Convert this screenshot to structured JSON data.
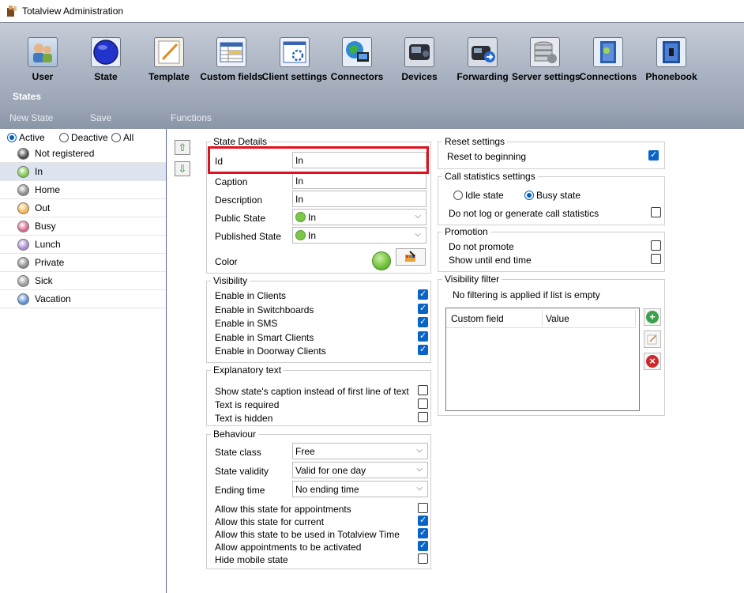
{
  "window": {
    "title": "Totalview  Administration"
  },
  "toolbar": {
    "section": "States",
    "items": [
      {
        "label": "User",
        "icon": "user-icon"
      },
      {
        "label": "State",
        "icon": "state-icon"
      },
      {
        "label": "Template",
        "icon": "template-icon"
      },
      {
        "label": "Custom fields",
        "icon": "custom-fields-icon"
      },
      {
        "label": "Client settings",
        "icon": "client-settings-icon"
      },
      {
        "label": "Connectors",
        "icon": "connectors-icon"
      },
      {
        "label": "Devices",
        "icon": "devices-icon"
      },
      {
        "label": "Forwarding",
        "icon": "forwarding-icon"
      },
      {
        "label": "Server settings",
        "icon": "server-settings-icon"
      },
      {
        "label": "Connections",
        "icon": "connections-icon"
      },
      {
        "label": "Phonebook",
        "icon": "phonebook-icon"
      }
    ]
  },
  "actions": {
    "new_state": "New State",
    "save": "Save",
    "functions": "Functions"
  },
  "filter": {
    "active": "Active",
    "deactive": "Deactive",
    "all": "All",
    "selected": "Active"
  },
  "states": [
    {
      "label": "Not registered",
      "color": "#4a4a4a"
    },
    {
      "label": "In",
      "color": "#7cc94a"
    },
    {
      "label": "Home",
      "color": "#8a8a8a"
    },
    {
      "label": "Out",
      "color": "#f2b64c"
    },
    {
      "label": "Busy",
      "color": "#d96a92"
    },
    {
      "label": "Lunch",
      "color": "#a98ad0"
    },
    {
      "label": "Private",
      "color": "#8a8a8a"
    },
    {
      "label": "Sick",
      "color": "#9a9a9a"
    },
    {
      "label": "Vacation",
      "color": "#5a8fd0"
    }
  ],
  "selected_state": "In",
  "state_details": {
    "title": "State Details",
    "id_label": "Id",
    "id_value": "In",
    "caption_label": "Caption",
    "caption_value": "In",
    "description_label": "Description",
    "description_value": "In",
    "public_state_label": "Public State",
    "public_state_value": "In",
    "published_state_label": "Published State",
    "published_state_value": "In",
    "color_label": "Color"
  },
  "visibility": {
    "title": "Visibility",
    "items": [
      {
        "label": "Enable in Clients",
        "checked": true
      },
      {
        "label": "Enable in Switchboards",
        "checked": true
      },
      {
        "label": "Enable in SMS",
        "checked": true
      },
      {
        "label": "Enable in Smart Clients",
        "checked": true
      },
      {
        "label": "Enable in Doorway Clients",
        "checked": true
      }
    ]
  },
  "explanatory": {
    "title": "Explanatory text",
    "items": [
      {
        "label": "Show state's caption instead of first line of text",
        "checked": false
      },
      {
        "label": "Text is required",
        "checked": false
      },
      {
        "label": "Text is hidden",
        "checked": false
      }
    ]
  },
  "behaviour": {
    "title": "Behaviour",
    "state_class_label": "State class",
    "state_class_value": "Free",
    "state_validity_label": "State validity",
    "state_validity_value": "Valid for one day",
    "ending_time_label": "Ending time",
    "ending_time_value": "No ending time",
    "items": [
      {
        "label": "Allow this state for appointments",
        "checked": false
      },
      {
        "label": "Allow this state for current",
        "checked": true
      },
      {
        "label": "Allow this state to be used in Totalview Time",
        "checked": true
      },
      {
        "label": "Allow appointments to be activated",
        "checked": true
      },
      {
        "label": "Hide mobile state",
        "checked": false
      }
    ]
  },
  "reset": {
    "title": "Reset settings",
    "label": "Reset to beginning",
    "checked": true
  },
  "call_stats": {
    "title": "Call statistics settings",
    "idle": "Idle state",
    "busy": "Busy state",
    "selected": "Busy state",
    "no_log_label": "Do not log or generate call statistics",
    "no_log_checked": false
  },
  "promotion": {
    "title": "Promotion",
    "items": [
      {
        "label": "Do not promote",
        "checked": false
      },
      {
        "label": "Show until end time",
        "checked": false
      }
    ]
  },
  "visibility_filter": {
    "title": "Visibility filter",
    "note": "No filtering is applied if list is empty",
    "col_custom_field": "Custom field",
    "col_value": "Value"
  }
}
